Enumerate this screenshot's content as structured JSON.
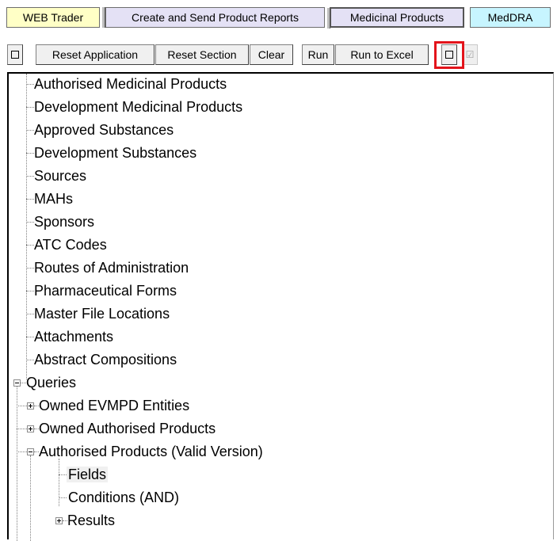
{
  "tabs": [
    {
      "label": "WEB Trader"
    },
    {
      "label": "Create and Send Product Reports"
    },
    {
      "label": "Medicinal Products"
    },
    {
      "label": "MedDRA"
    }
  ],
  "toolbar": {
    "reset_application": "Reset Application",
    "reset_section": "Reset Section",
    "clear": "Clear",
    "run": "Run",
    "run_to_excel": "Run to Excel",
    "checkbox_icon": "☑"
  },
  "tree": {
    "items": [
      "Authorised Medicinal Products",
      "Development Medicinal Products",
      "Approved Substances",
      "Development Substances",
      "Sources",
      "MAHs",
      "Sponsors",
      "ATC Codes",
      "Routes of Administration",
      "Pharmaceutical Forms",
      "Master File Locations",
      "Attachments",
      "Abstract Compositions"
    ],
    "queries": {
      "label": "Queries",
      "children": [
        "Owned EVMPD Entities",
        "Owned Authorised Products",
        "Authorised Products (Valid Version)"
      ],
      "valid_version_children": [
        "Fields",
        "Conditions (AND)",
        "Results"
      ]
    }
  },
  "colors": {
    "tab_web_trader": "#ffffc6",
    "tab_reports": "#e4e1f5",
    "tab_medicinal": "#e4e1f5",
    "tab_meddra": "#c7f5ff",
    "highlight": "#e3141b"
  }
}
